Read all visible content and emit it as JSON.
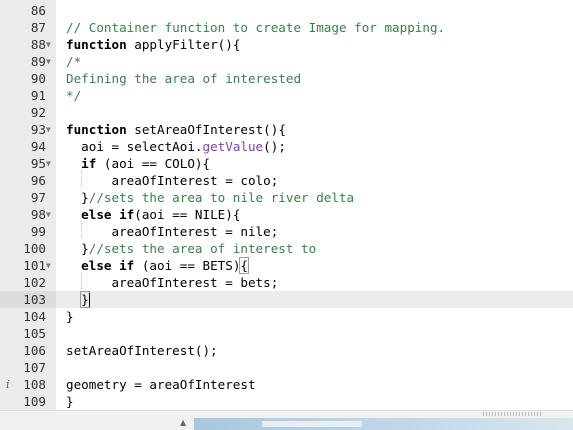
{
  "editor": {
    "lines": [
      {
        "n": "86",
        "fold": false,
        "text": ""
      },
      {
        "n": "87",
        "fold": false,
        "text": "// Container function to create Image for mapping."
      },
      {
        "n": "88",
        "fold": true,
        "text": "function applyFilter(){"
      },
      {
        "n": "89",
        "fold": true,
        "text": "/*"
      },
      {
        "n": "90",
        "fold": false,
        "text": "Defining the area of interested"
      },
      {
        "n": "91",
        "fold": false,
        "text": "*/"
      },
      {
        "n": "92",
        "fold": false,
        "text": ""
      },
      {
        "n": "93",
        "fold": true,
        "text": "function setAreaOfInterest(){"
      },
      {
        "n": "94",
        "fold": false,
        "text": "  aoi = selectAoi.getValue();"
      },
      {
        "n": "95",
        "fold": true,
        "text": "  if (aoi == COLO){"
      },
      {
        "n": "96",
        "fold": false,
        "text": "      areaOfInterest = colo;"
      },
      {
        "n": "97",
        "fold": false,
        "text": "  }//sets the area to nile river delta"
      },
      {
        "n": "98",
        "fold": true,
        "text": "  else if(aoi == NILE){"
      },
      {
        "n": "99",
        "fold": false,
        "text": "      areaOfInterest = nile;"
      },
      {
        "n": "100",
        "fold": false,
        "text": "  }//sets the area of interest to"
      },
      {
        "n": "101",
        "fold": true,
        "text": "  else if (aoi == BETS){"
      },
      {
        "n": "102",
        "fold": false,
        "text": "      areaOfInterest = bets;"
      },
      {
        "n": "103",
        "fold": false,
        "text": "  }"
      },
      {
        "n": "104",
        "fold": false,
        "text": "}"
      },
      {
        "n": "105",
        "fold": false,
        "text": ""
      },
      {
        "n": "106",
        "fold": false,
        "text": "setAreaOfInterest();"
      },
      {
        "n": "107",
        "fold": false,
        "text": ""
      },
      {
        "n": "108",
        "fold": false,
        "text": "geometry = areaOfInterest"
      },
      {
        "n": "109",
        "fold": false,
        "text": "}"
      }
    ],
    "segments": {
      "l87": "// Container function to create Image for mapping.",
      "l88_kw": "function",
      "l88_rest": " applyFilter(){",
      "l89": "/*",
      "l90": "Defining the area of interested",
      "l91": "*/",
      "l93_kw": "function",
      "l93_rest": " setAreaOfInterest(){",
      "l94_a": "  aoi = selectAoi.",
      "l94_m": "getValue",
      "l94_b": "();",
      "l95_kw": "  if",
      "l95_rest": " (aoi == COLO){",
      "l96": "      areaOfInterest = colo;",
      "l97_b": "  }",
      "l97_cm": "//sets the area to nile river delta",
      "l98_kw": "  else if",
      "l98_rest": "(aoi == NILE){",
      "l99": "      areaOfInterest = nile;",
      "l100_b": "  }",
      "l100_cm": "//sets the area of interest to",
      "l101_kw": "  else if",
      "l101_rest": " (aoi == BETS)",
      "l101_br": "{",
      "l102": "      areaOfInterest = bets;",
      "l103_pre": "  ",
      "l103_br": "}",
      "l104": "}",
      "l106": "setAreaOfInterest();",
      "l108": "geometry = areaOfInterest",
      "l109": "}"
    },
    "active_line": "103",
    "info_line": "108",
    "info_icon": "info-icon"
  },
  "colors": {
    "comment": "#3a7f4b",
    "method": "#7b3fb2",
    "gutter_bg": "#ebebeb",
    "active_line_bg": "#ececec"
  }
}
